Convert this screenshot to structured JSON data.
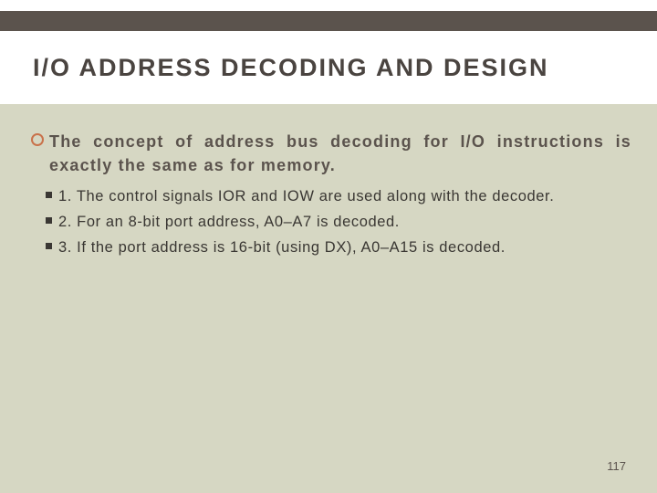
{
  "title": "I/O ADDRESS DECODING AND DESIGN",
  "lead": "The concept of address bus decoding for I/O instructions is exactly the same as for memory.",
  "bullets": {
    "b1": "1. The control signals IOR and IOW are used along with the decoder.",
    "b2": "2. For an 8-bit port address, A0–A7 is decoded.",
    "b3": "3. If the port address is 16-bit (using DX), A0–A15 is decoded."
  },
  "page_number": "117"
}
